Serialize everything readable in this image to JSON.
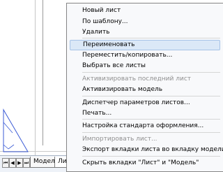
{
  "menu": {
    "items": [
      {
        "label": "Новый лист",
        "enabled": true
      },
      {
        "label": "По шаблону...",
        "enabled": true
      },
      {
        "label": "Удалить",
        "enabled": true
      },
      {
        "label": "Переименовать",
        "enabled": true,
        "highlighted": true
      },
      {
        "label": "Переместить/копировать...",
        "enabled": true
      },
      {
        "label": "Выбрать все листы",
        "enabled": true
      },
      {
        "label": "Активизировать последний лист",
        "enabled": false
      },
      {
        "label": "Активизировать модель",
        "enabled": true
      },
      {
        "label": "Диспетчер параметров листов...",
        "enabled": true
      },
      {
        "label": "Печать...",
        "enabled": true
      },
      {
        "label": "Настройка стандарта оформления...",
        "enabled": true
      },
      {
        "label": "Импортировать лист...",
        "enabled": false
      },
      {
        "label": "Экспорт вкладки листа во вкладку модели...",
        "enabled": true
      },
      {
        "label": "Скрыть вкладки \"Лист\" и \"Модель\"",
        "enabled": true
      }
    ]
  },
  "tabs": {
    "model": "Модель",
    "sheet": "Лист"
  },
  "nav": {
    "first": "⏮",
    "prev": "◀",
    "next": "▶",
    "last": "⏭"
  },
  "colors": {
    "menu_highlight": "#dbe8f7",
    "triangle_stroke": "#3b5bd6"
  }
}
